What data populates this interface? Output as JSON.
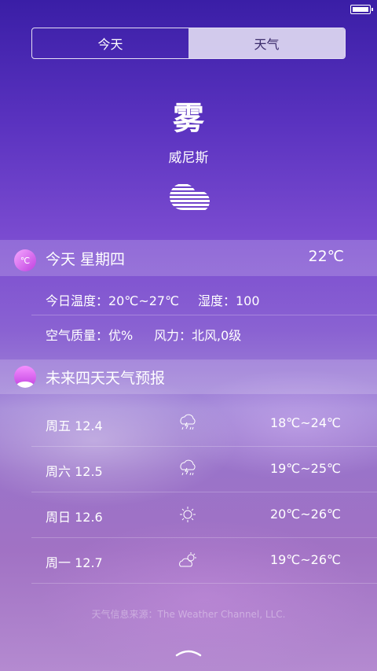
{
  "tabs": [
    {
      "label": "今天",
      "active": true
    },
    {
      "label": "天气",
      "active": false
    }
  ],
  "current": {
    "condition": "雾",
    "city": "威尼斯",
    "icon": "fog-cloud-icon"
  },
  "today": {
    "title": "今天 星期四",
    "temp": "22℃",
    "badge": "℃",
    "temp_range": "今日温度：20℃~27℃",
    "humidity": "湿度：100",
    "air_quality": "空气质量：优%",
    "wind": "风力：北风,0级"
  },
  "forecast": {
    "title": "未来四天天气预报",
    "days": [
      {
        "day": "周五 12.4",
        "icon": "thunder-rain-icon",
        "range": "18℃~24℃"
      },
      {
        "day": "周六 12.5",
        "icon": "thunder-rain-icon",
        "range": "19℃~25℃"
      },
      {
        "day": "周日 12.6",
        "icon": "sun-icon",
        "range": "20℃~26℃"
      },
      {
        "day": "周一 12.7",
        "icon": "partly-cloudy-icon",
        "range": "19℃~26℃"
      }
    ]
  },
  "source": "天气信息来源：The Weather Channel, LLC."
}
